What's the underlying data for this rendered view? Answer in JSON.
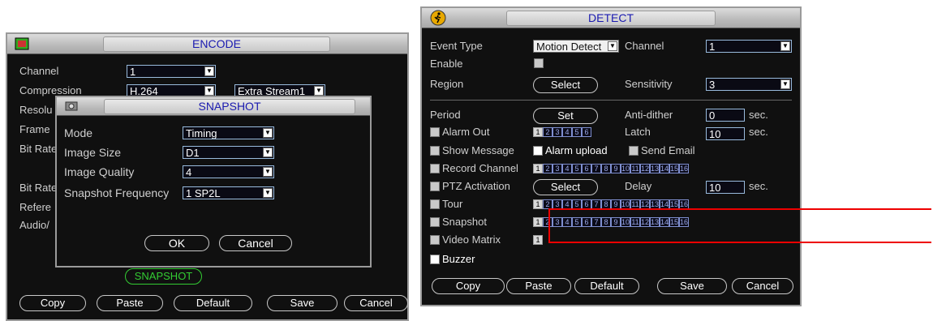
{
  "encode": {
    "title": "ENCODE",
    "rows": {
      "channel_label": "Channel",
      "channel_value": "1",
      "compression_label": "Compression",
      "compression_value": "H.264",
      "extra_stream": "Extra Stream1",
      "resolution_label": "Resolu",
      "frame_label": "Frame",
      "bitrate1_label": "Bit Rate",
      "bitrate2_label": "Bit Rate",
      "reference_label": "Refere",
      "audio_label": "Audio/"
    },
    "snapshot_button": "SNAPSHOT",
    "buttons": {
      "copy": "Copy",
      "paste": "Paste",
      "default": "Default",
      "save": "Save",
      "cancel": "Cancel"
    }
  },
  "snapshot_dialog": {
    "title": "SNAPSHOT",
    "mode_label": "Mode",
    "mode_value": "Timing",
    "size_label": "Image Size",
    "size_value": "D1",
    "quality_label": "Image Quality",
    "quality_value": "4",
    "freq_label": "Snapshot Frequency",
    "freq_value": "1 SP2L",
    "ok": "OK",
    "cancel": "Cancel"
  },
  "detect": {
    "title": "DETECT",
    "event_type_label": "Event Type",
    "event_type_value": "Motion Detect",
    "channel_label": "Channel",
    "channel_value": "1",
    "enable_label": "Enable",
    "region_label": "Region",
    "region_button": "Select",
    "sensitivity_label": "Sensitivity",
    "sensitivity_value": "3",
    "period_label": "Period",
    "period_button": "Set",
    "antidither_label": "Anti-dither",
    "antidither_value": "0",
    "sec1": "sec.",
    "alarm_out_label": "Alarm Out",
    "latch_label": "Latch",
    "latch_value": "10",
    "sec2": "sec.",
    "show_message_label": "Show Message",
    "alarm_upload_label": "Alarm upload",
    "send_email_label": "Send Email",
    "record_channel_label": "Record Channel",
    "ptz_label": "PTZ Activation",
    "ptz_button": "Select",
    "delay_label": "Delay",
    "delay_value": "10",
    "sec3": "sec.",
    "tour_label": "Tour",
    "snapshot_label": "Snapshot",
    "video_matrix_label": "Video Matrix",
    "buzzer_label": "Buzzer",
    "buttons": {
      "copy": "Copy",
      "paste": "Paste",
      "default": "Default",
      "save": "Save",
      "cancel": "Cancel"
    },
    "nums6": [
      "1",
      "2",
      "3",
      "4",
      "5",
      "6"
    ],
    "nums16": [
      "1",
      "2",
      "3",
      "4",
      "5",
      "6",
      "7",
      "8",
      "9",
      "10",
      "11",
      "12",
      "13",
      "14",
      "15",
      "16"
    ],
    "nums1": [
      "1"
    ]
  }
}
